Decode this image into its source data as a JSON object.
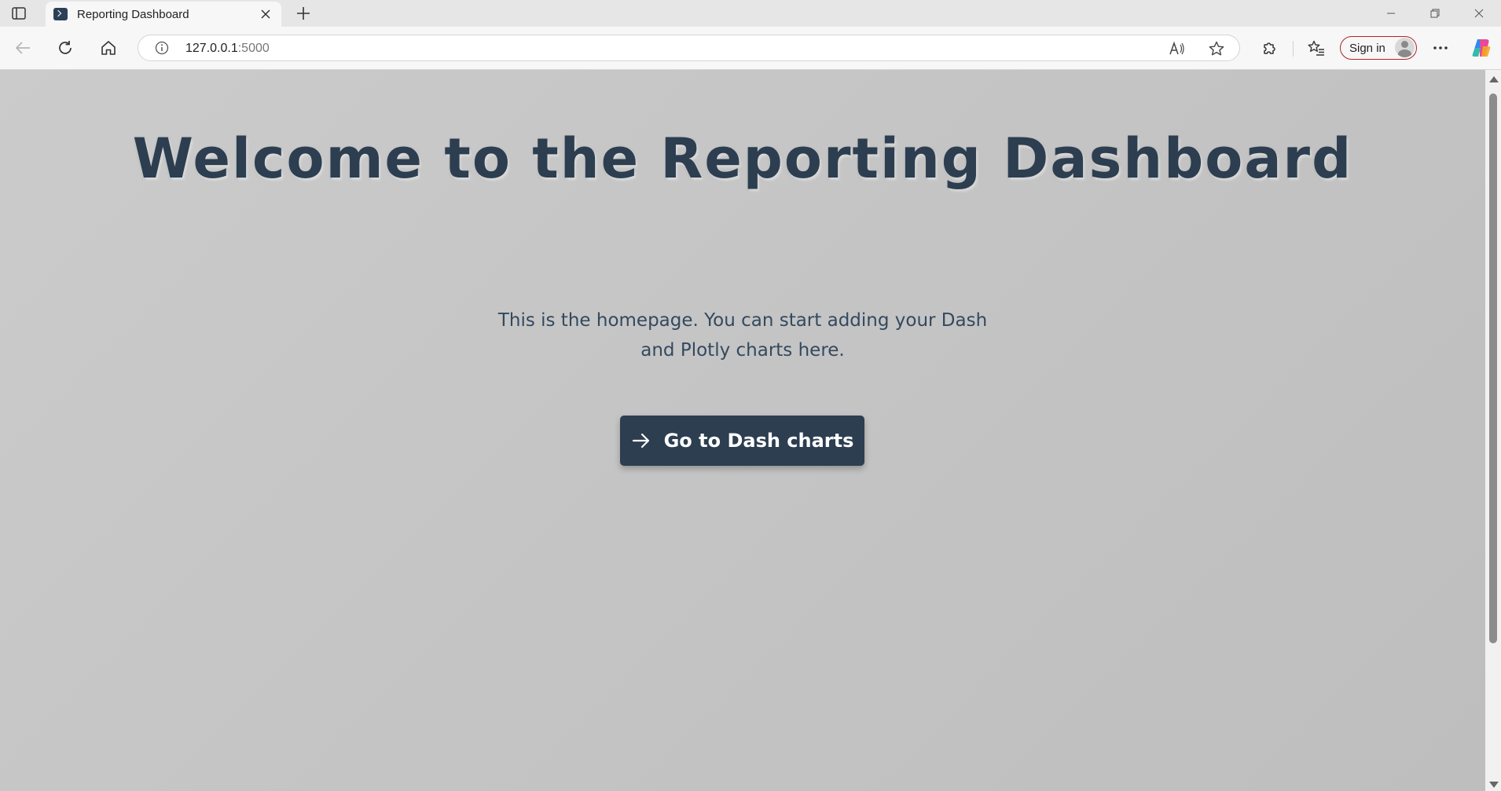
{
  "browser": {
    "tab": {
      "title": "Reporting Dashboard"
    },
    "address": {
      "host": "127.0.0.1",
      "port": ":5000"
    },
    "signin_label": "Sign in"
  },
  "page": {
    "title": "Welcome to the Reporting Dashboard",
    "intro": "This is the homepage. You can start adding your Dash and Plotly charts here.",
    "cta_label": "Go to Dash charts"
  },
  "colors": {
    "heading": "#2c3e50",
    "button_bg": "#2c3e50",
    "background": "#c8c8c8",
    "signin_border": "#b3202a"
  },
  "icons": {
    "tab_actions": "tab-actions-icon",
    "favicon": "terminal-favicon-icon",
    "close": "close-icon",
    "new_tab": "plus-icon",
    "back": "back-arrow-icon",
    "refresh": "refresh-icon",
    "home": "home-icon",
    "info": "info-icon",
    "read_aloud": "read-aloud-icon",
    "favorite": "star-icon",
    "extensions": "puzzle-icon",
    "favorites": "favorites-list-icon",
    "more": "more-icon",
    "copilot": "copilot-icon",
    "cta": "arrow-right-icon"
  }
}
